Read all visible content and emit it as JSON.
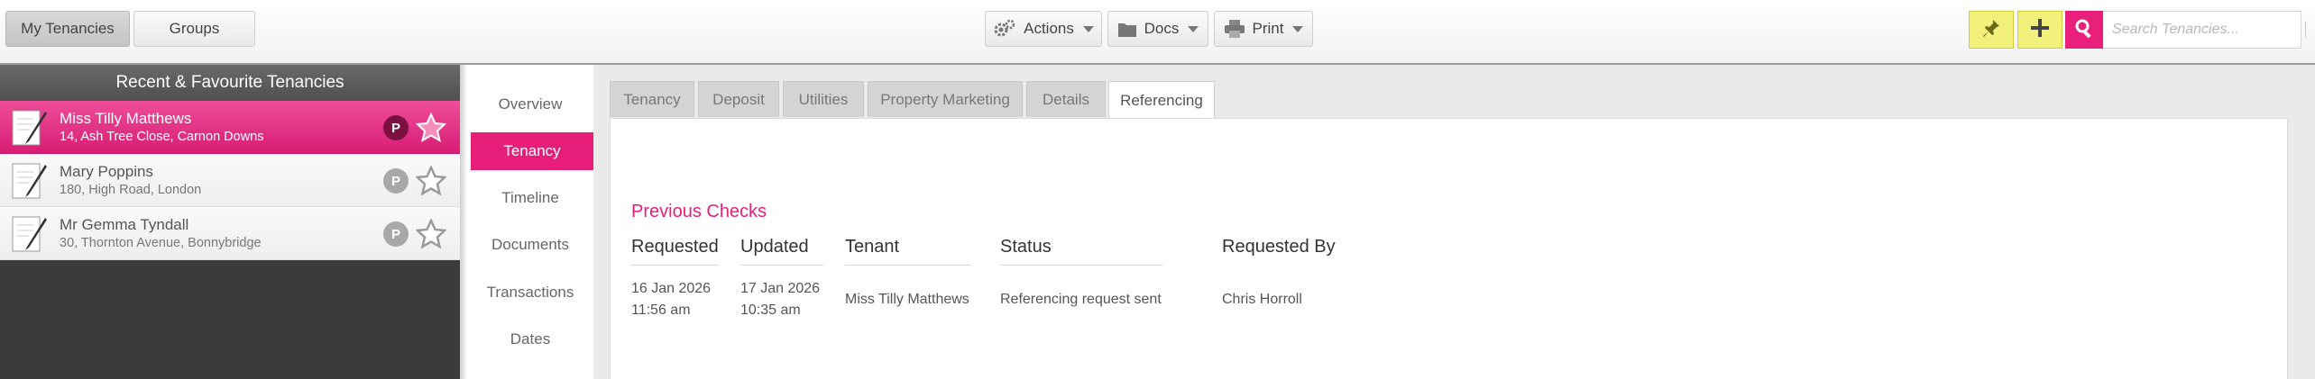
{
  "topbar": {
    "my_tenancies": "My Tenancies",
    "groups": "Groups",
    "actions": "Actions",
    "docs": "Docs",
    "print": "Print",
    "search_placeholder": "Search Tenancies..."
  },
  "sidebar": {
    "title": "Recent & Favourite Tenancies",
    "items": [
      {
        "name": "Miss Tilly Matthews",
        "address": "14, Ash Tree Close, Carnon Downs",
        "badge": "P"
      },
      {
        "name": "Mary Poppins",
        "address": "180, High Road, London",
        "badge": "P"
      },
      {
        "name": "Mr Gemma Tyndall",
        "address": "30, Thornton Avenue, Bonnybridge",
        "badge": "P"
      }
    ]
  },
  "subnav": [
    "Overview",
    "Tenancy",
    "Timeline",
    "Documents",
    "Transactions",
    "Dates"
  ],
  "tabs": [
    "Tenancy",
    "Deposit",
    "Utilities",
    "Property Marketing",
    "Details",
    "Referencing"
  ],
  "checks": {
    "title": "Previous Checks",
    "headers": [
      "Requested",
      "Updated",
      "Tenant",
      "Status",
      "Requested By"
    ],
    "rows": [
      {
        "requested_date": "16 Jan 2026",
        "requested_time": "11:56 am",
        "updated_date": "17 Jan 2026",
        "updated_time": "10:35 am",
        "tenant": "Miss Tilly Matthews",
        "status": "Referencing request sent",
        "requested_by": "Chris Horroll"
      }
    ]
  },
  "colors": {
    "accent": "#e61e79",
    "sidebar_dark": "#3b3b3b",
    "pin_yellow": "#f2f07a"
  },
  "icons": [
    "gears-icon",
    "folder-icon",
    "printer-icon",
    "pin-icon",
    "plus-icon",
    "search-icon",
    "document-pen-icon",
    "star-icon"
  ]
}
